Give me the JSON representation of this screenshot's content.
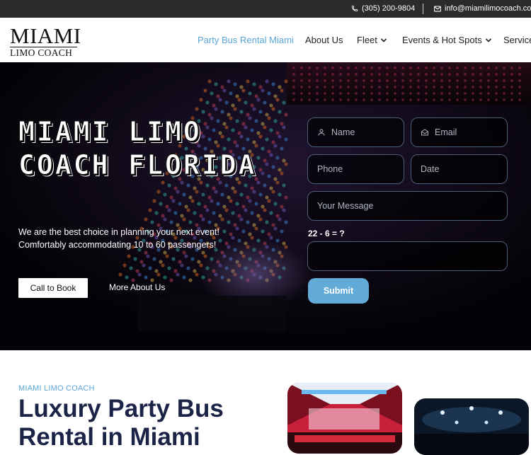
{
  "topbar": {
    "phone": "(305) 200-9804",
    "email": "info@miamilimocoach.com",
    "phone_icon": "phone-icon",
    "email_icon": "envelope-icon"
  },
  "logo": {
    "line1": "MIAMI",
    "line2": "LIMO COACH"
  },
  "nav": {
    "items": [
      {
        "label": "Party Bus Rental Miami",
        "active": true,
        "dropdown": false
      },
      {
        "label": "About Us",
        "active": false,
        "dropdown": false
      },
      {
        "label": "Fleet",
        "active": false,
        "dropdown": true
      },
      {
        "label": "Events & Hot Spots",
        "active": false,
        "dropdown": true
      },
      {
        "label": "Services",
        "active": false,
        "dropdown": false
      }
    ]
  },
  "hero": {
    "title": "MIAMI LIMO COACH FLORIDA",
    "subtitle_line1": "We are the best choice in planning your next event!",
    "subtitle_line2": "Comfortably accommodating 10 to 60 passengers!",
    "call_button": "Call to Book",
    "more_button": "More About Us"
  },
  "form": {
    "name_placeholder": "Name",
    "email_placeholder": "Email",
    "phone_placeholder": "Phone",
    "date_placeholder": "Date",
    "message_placeholder": "Your Message",
    "captcha_label": "22 - 6 = ?",
    "captcha_value": "",
    "submit_label": "Submit"
  },
  "section": {
    "kicker": "MIAMI LIMO COACH",
    "heading": "Luxury Party Bus Rental in Miami"
  },
  "colors": {
    "accent": "#5aa6d6",
    "heading": "#1b2447",
    "topbar": "#2b2b2b",
    "submit": "#62aad8"
  }
}
